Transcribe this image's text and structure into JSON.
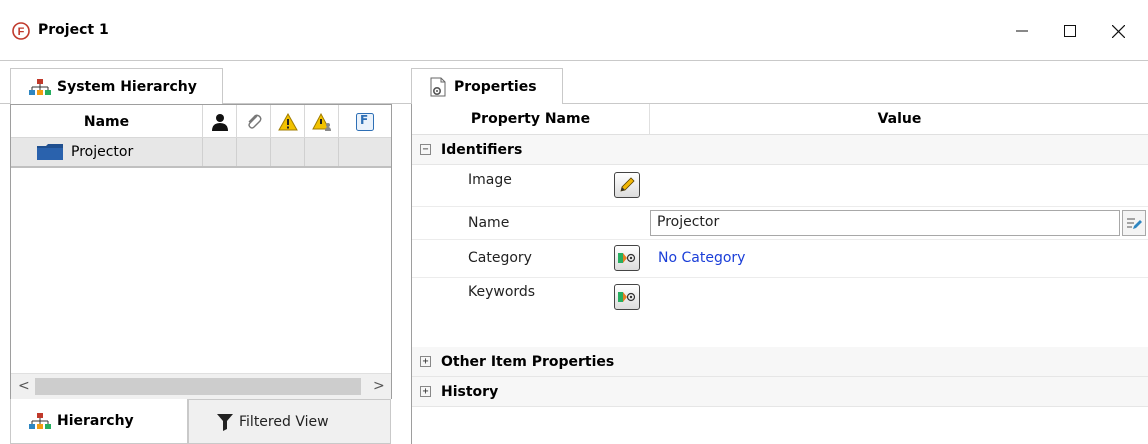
{
  "window": {
    "title": "Project 1",
    "minimize_glyph": "—",
    "maximize_glyph": "☐",
    "close_glyph": "✕"
  },
  "left_panel": {
    "tab_label": "System Hierarchy",
    "columns": {
      "name": "Name",
      "icons": [
        "person-icon",
        "paperclip-icon",
        "warning-icon",
        "warning-user-icon",
        "f-icon"
      ],
      "f_letter": "F"
    },
    "rows": [
      {
        "name": "Projector",
        "icon": "folder-icon"
      }
    ],
    "scroll_left": "<",
    "scroll_right": ">",
    "bottom_tabs": {
      "hierarchy": "Hierarchy",
      "filtered_view": "Filtered View"
    }
  },
  "right_panel": {
    "tab_label": "Properties",
    "header": {
      "property_name": "Property Name",
      "value": "Value"
    },
    "groups": {
      "identifiers": {
        "label": "Identifiers",
        "toggle": "−"
      },
      "other": {
        "label": "Other Item Properties",
        "toggle": "+"
      },
      "history": {
        "label": "History",
        "toggle": "+"
      }
    },
    "properties": {
      "image": {
        "label": "Image"
      },
      "name": {
        "label": "Name",
        "value": "Projector"
      },
      "category": {
        "label": "Category",
        "value": "No Category"
      },
      "keywords": {
        "label": "Keywords"
      }
    }
  },
  "colors": {
    "link": "#1a3ed8",
    "app_icon_red": "#c0392b",
    "folder_blue": "#1f4f8f",
    "warning_yellow": "#f2c200"
  }
}
